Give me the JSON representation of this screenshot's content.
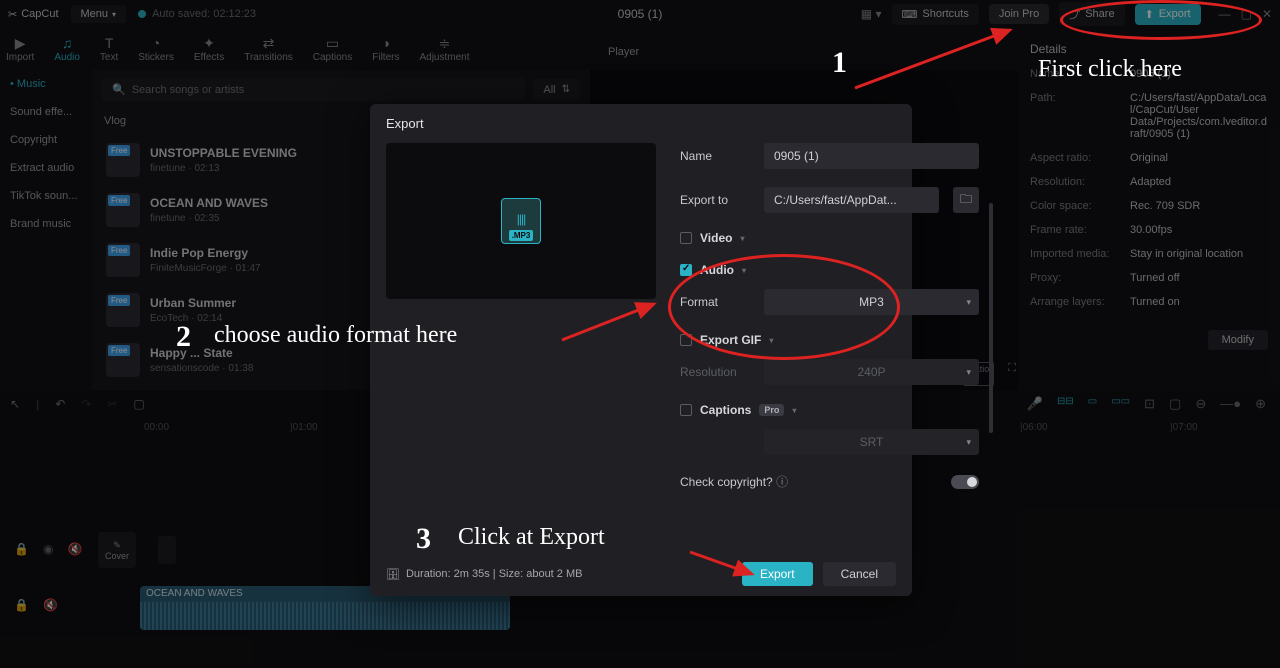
{
  "topbar": {
    "logo": "CapCut",
    "menu": "Menu",
    "autosave": "Auto saved: 02:12:23",
    "project": "0905 (1)",
    "shortcuts": "Shortcuts",
    "join_pro": "Join Pro",
    "share": "Share",
    "export": "Export"
  },
  "tooltabs": [
    {
      "label": "Import",
      "icon": "▶"
    },
    {
      "label": "Audio",
      "icon": "♫",
      "active": true
    },
    {
      "label": "Text",
      "icon": "T"
    },
    {
      "label": "Stickers",
      "icon": "◔"
    },
    {
      "label": "Effects",
      "icon": "✦"
    },
    {
      "label": "Transitions",
      "icon": "⇄"
    },
    {
      "label": "Captions",
      "icon": "▭"
    },
    {
      "label": "Filters",
      "icon": "◑"
    },
    {
      "label": "Adjustment",
      "icon": "≑"
    }
  ],
  "sidebar": {
    "items": [
      {
        "label": "Music",
        "active": true
      },
      {
        "label": "Sound effe..."
      },
      {
        "label": "Copyright"
      },
      {
        "label": "Extract audio"
      },
      {
        "label": "TikTok soun..."
      },
      {
        "label": "Brand music"
      }
    ]
  },
  "media": {
    "search_placeholder": "Search songs or artists",
    "all": "All",
    "category": "Vlog",
    "tracks": [
      {
        "title": "UNSTOPPABLE EVENING",
        "sub": "finetune · 02:13",
        "badge": "Free"
      },
      {
        "title": "OCEAN AND WAVES",
        "sub": "finetune · 02:35",
        "badge": "Free"
      },
      {
        "title": "Indie Pop Energy",
        "sub": "FiniteMusicForge · 01:47",
        "badge": "Free"
      },
      {
        "title": "Urban Summer",
        "sub": "EcoTech · 02:14",
        "badge": "Free"
      },
      {
        "title": "Happy ... State",
        "sub": "sensationscode · 01:38",
        "badge": "Free"
      }
    ]
  },
  "player_label": "Player",
  "details": {
    "title": "Details",
    "rows": [
      {
        "k": "Name:",
        "v": "0905 (1)"
      },
      {
        "k": "Path:",
        "v": "C:/Users/fast/AppData/Local/CapCut/User Data/Projects/com.lveditor.draft/0905 (1)"
      },
      {
        "k": "Aspect ratio:",
        "v": "Original"
      },
      {
        "k": "Resolution:",
        "v": "Adapted"
      },
      {
        "k": "Color space:",
        "v": "Rec. 709 SDR"
      },
      {
        "k": "Frame rate:",
        "v": "30.00fps"
      },
      {
        "k": "Imported media:",
        "v": "Stay in original location"
      },
      {
        "k": "Proxy:",
        "v": "Turned off"
      },
      {
        "k": "Arrange layers:",
        "v": "Turned on"
      }
    ],
    "modify": "Modify"
  },
  "timeline": {
    "ruler": [
      "00:00",
      "|01:00",
      "|06:00",
      "|07:00"
    ],
    "cover": "Cover",
    "clip_label": "OCEAN AND WAVES"
  },
  "export": {
    "title": "Export",
    "mp3": ".MP3",
    "name_label": "Name",
    "name_value": "0905 (1)",
    "export_to_label": "Export to",
    "export_to_value": "C:/Users/fast/AppDat...",
    "video_section": "Video",
    "audio_section": "Audio",
    "format_label": "Format",
    "format_value": "MP3",
    "gif_section": "Export GIF",
    "resolution_label": "Resolution",
    "resolution_value": "240P",
    "captions_section": "Captions",
    "captions_value": "SRT",
    "copyright": "Check copyright?",
    "duration": "Duration: 2m 35s | Size: about 2 MB",
    "export_btn": "Export",
    "cancel_btn": "Cancel"
  },
  "anno": {
    "step1_num": "1",
    "step1": "First click here",
    "step2_num": "2",
    "step2": "choose audio format here",
    "step3_num": "3",
    "step3": "Click at Export"
  }
}
